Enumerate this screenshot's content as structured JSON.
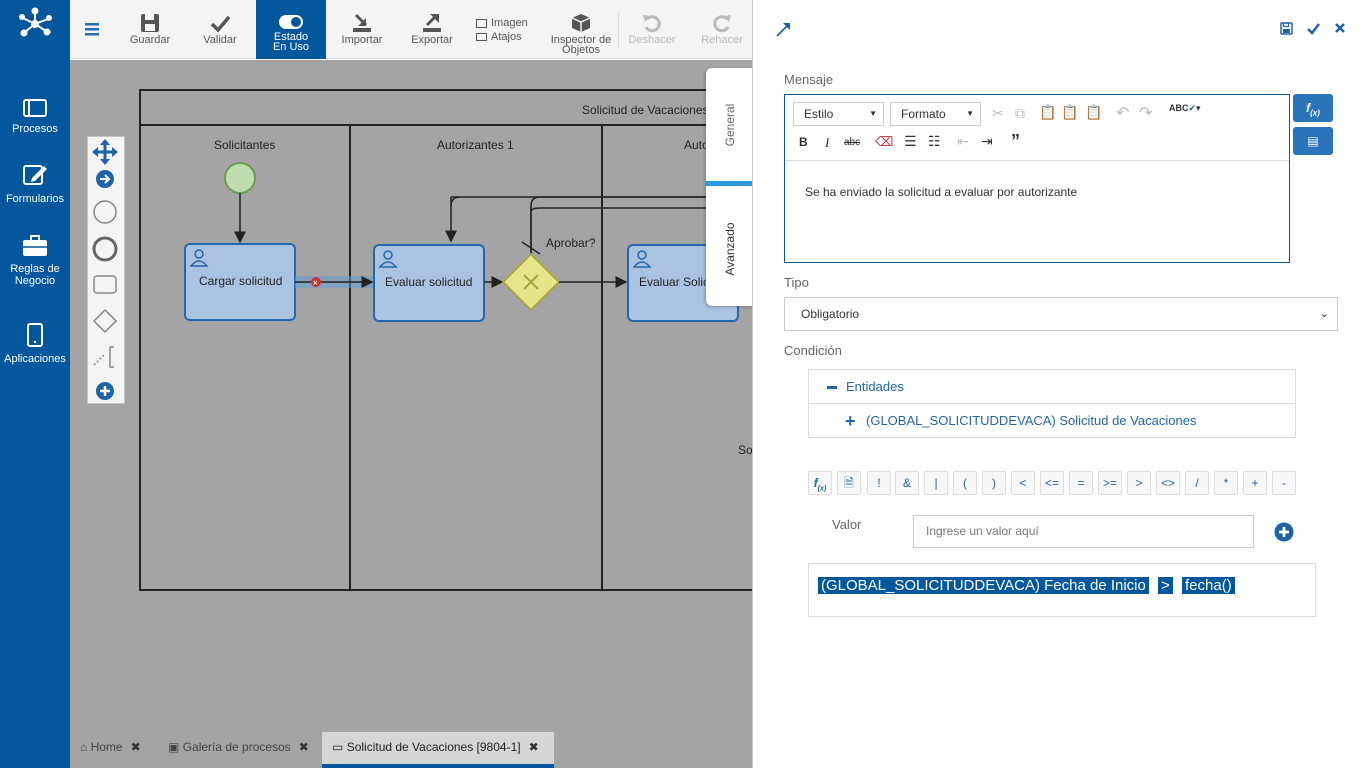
{
  "nav": {
    "items": [
      {
        "label": "Procesos",
        "icon": "processes-icon"
      },
      {
        "label": "Formularios",
        "icon": "forms-icon"
      },
      {
        "label": "Reglas de Negocio",
        "icon": "business-rules-icon"
      },
      {
        "label": "Aplicaciones",
        "icon": "applications-icon"
      }
    ]
  },
  "toolbar": {
    "menu_icon": "hamburger-icon",
    "save": "Guardar",
    "validate": "Validar",
    "state_line1": "Estado",
    "state_line2": "En Uso",
    "import": "Importar",
    "export": "Exportar",
    "image": "Imagen",
    "shortcuts": "Atajos",
    "inspector_line1": "Inspector de",
    "inspector_line2": "Objetos",
    "undo": "Deshacer",
    "redo": "Rehacer"
  },
  "diagram": {
    "pool_title": "Solicitud de Vacaciones",
    "lanes": [
      "Solicitantes",
      "Autorizantes 1",
      "Autor"
    ],
    "tasks": [
      "Cargar solicitud",
      "Evaluar solicitud",
      "Evaluar Solic"
    ],
    "gateway_label": "Aprobar?",
    "partial_label": "So"
  },
  "vtabs": {
    "general": "General",
    "advanced": "Avanzado"
  },
  "bottom_tabs": [
    {
      "label": "Home",
      "icon": "home-icon"
    },
    {
      "label": "Galería de procesos",
      "icon": "gallery-icon"
    },
    {
      "label": "Solicitud de Vacaciones [9804-1]",
      "icon": "window-icon"
    }
  ],
  "panel": {
    "mensaje_label": "Mensaje",
    "editor": {
      "style_select": "Estilo",
      "format_select": "Formato",
      "body_text": "Se ha enviado la solicitud a evaluar por autorizante"
    },
    "tipo_label": "Tipo",
    "tipo_value": "Obligatorio",
    "condicion_label": "Condición",
    "tree": {
      "root": "Entidades",
      "child": "(GLOBAL_SOLICITUDDEVACA) Solicitud de Vacaciones"
    },
    "operators": [
      "!",
      "&",
      "|",
      "(",
      ")",
      "<",
      "<=",
      "=",
      ">=",
      ">",
      "<>",
      "/",
      "*",
      "+",
      "-"
    ],
    "valor_label": "Valor",
    "valor_placeholder": "Ingrese un valor aquí",
    "expression": [
      "(GLOBAL_SOLICITUDDEVACA) Fecha de Inicio",
      ">",
      "fecha()"
    ]
  },
  "colors": {
    "brand": "#03579c",
    "button_blue": "#2b74b9",
    "canvas_gray": "#a4a4a4"
  }
}
